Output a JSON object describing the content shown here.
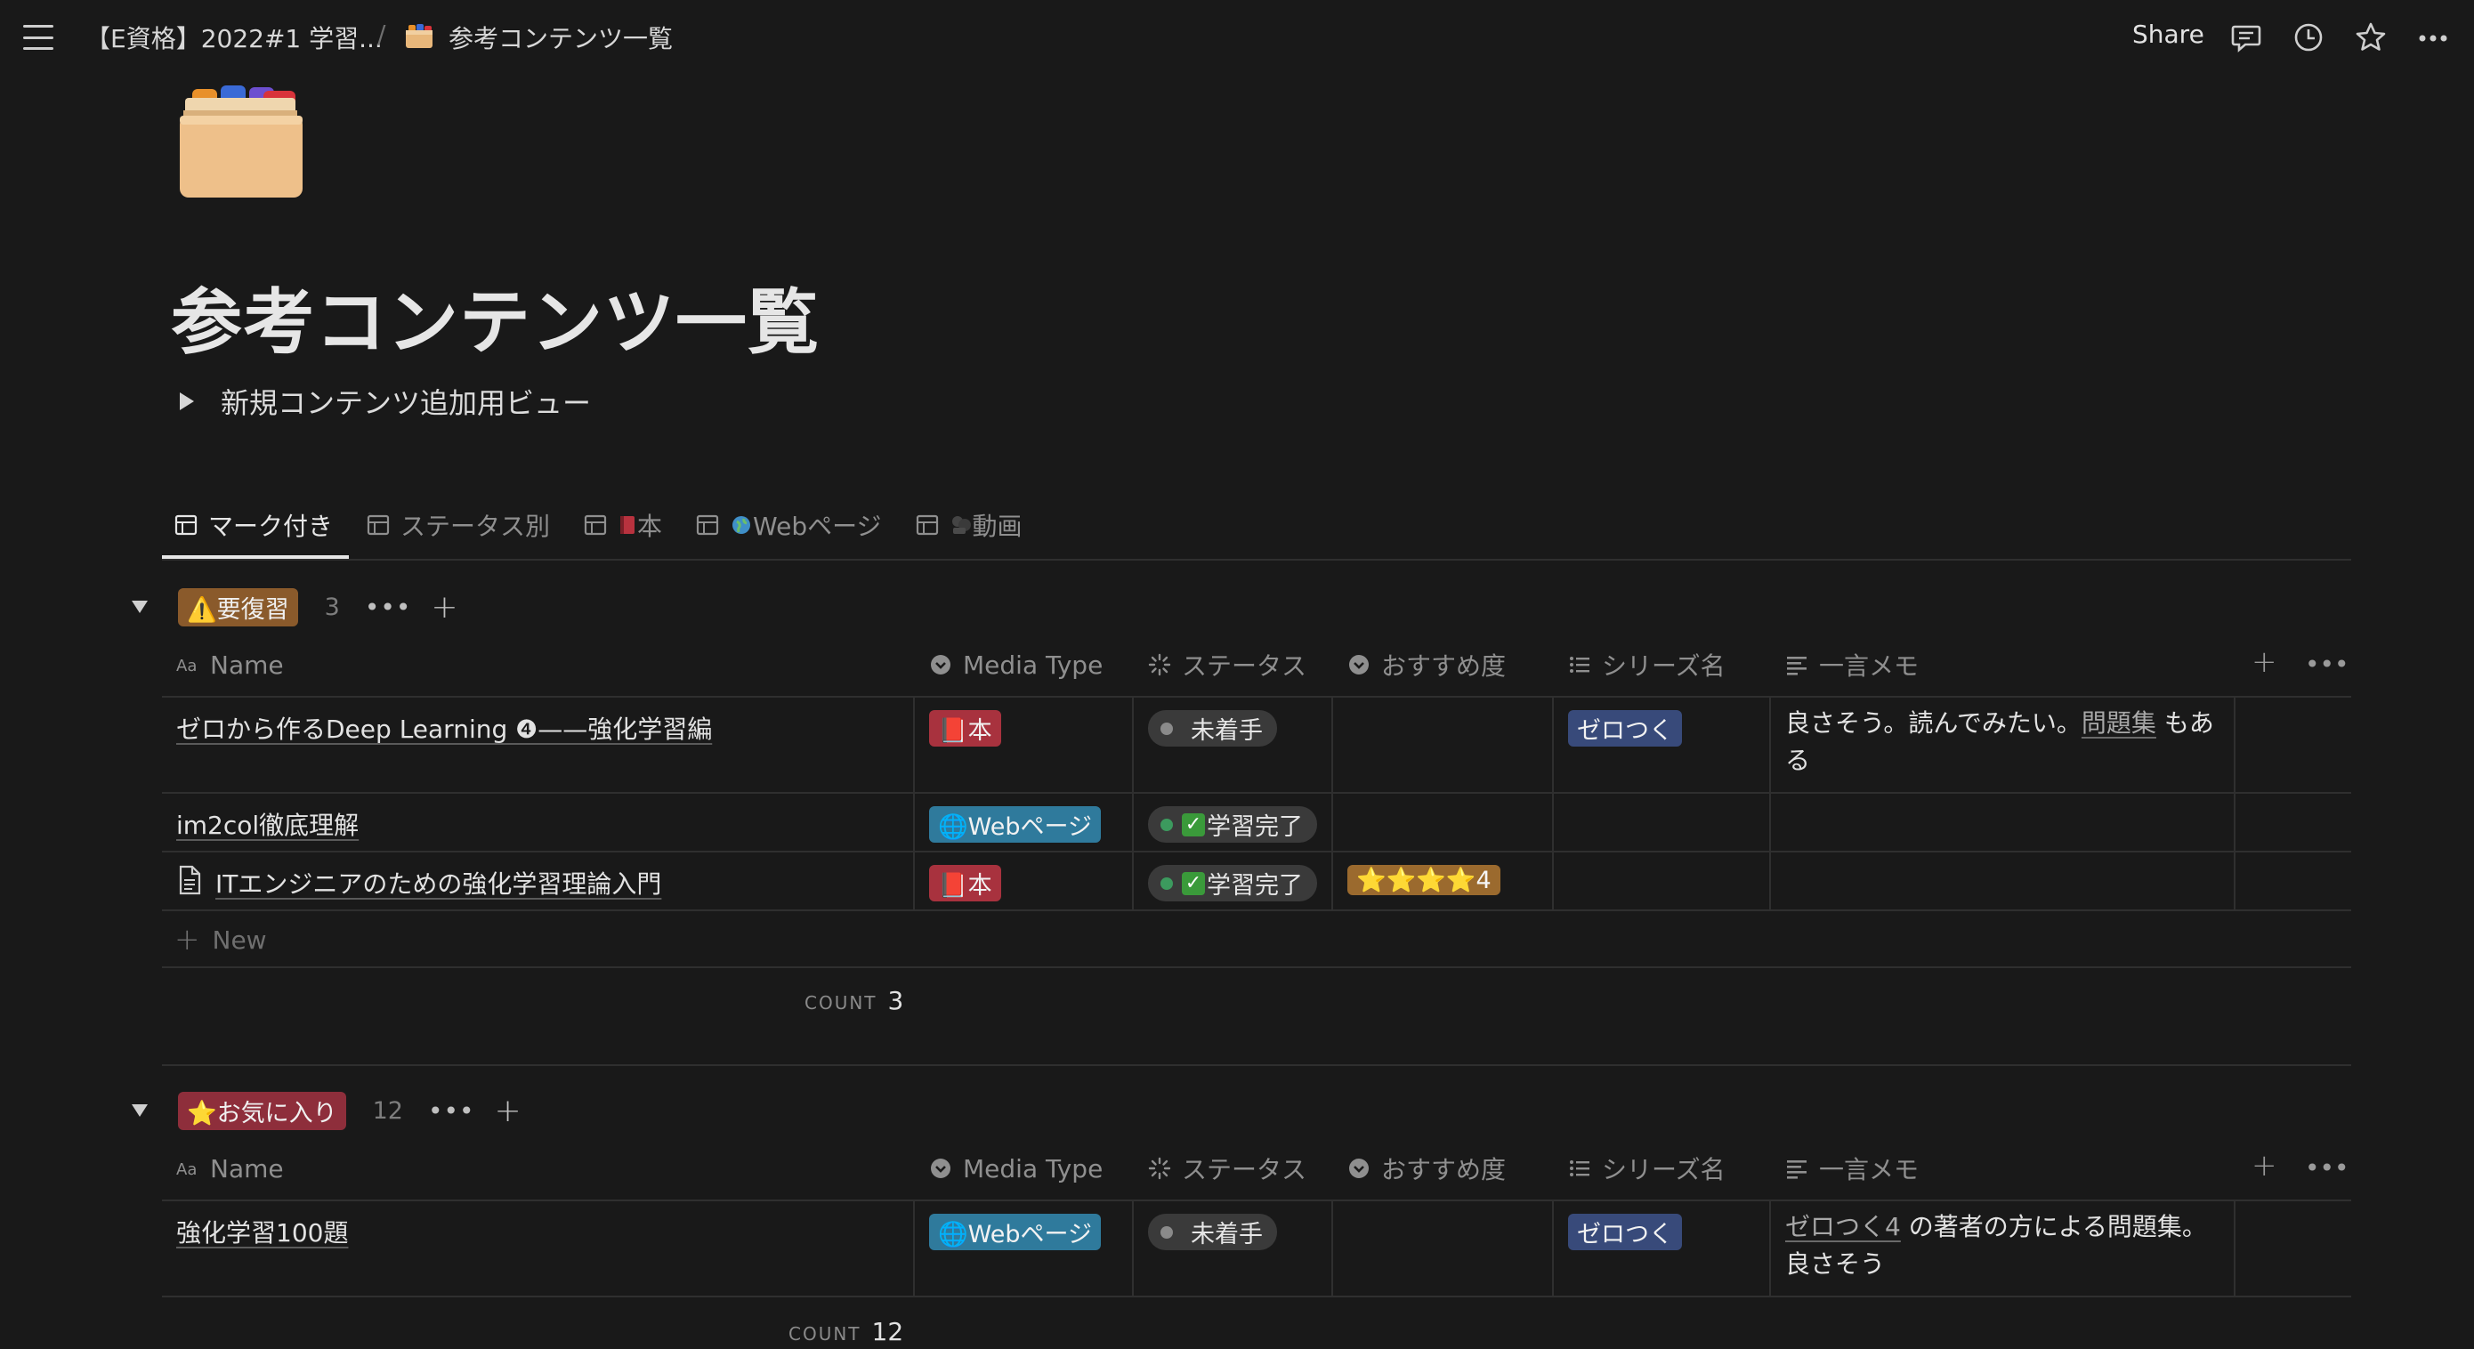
{
  "topbar": {
    "workspace_crumb": "【E資格】2022#1 学習...",
    "separator": "/",
    "page_crumb": "参考コンテンツ一覧",
    "share_label": "Share"
  },
  "page": {
    "title": "参考コンテンツ一覧",
    "toggle_label": "新規コンテンツ追加用ビュー"
  },
  "tabs": [
    {
      "label": "マーク付き"
    },
    {
      "label": "ステータス別"
    },
    {
      "label": "本"
    },
    {
      "label": "Webページ"
    },
    {
      "label": "動画"
    }
  ],
  "columns": {
    "name": "Name",
    "media_type": "Media Type",
    "status": "ステータス",
    "recommend": "おすすめ度",
    "series": "シリーズ名",
    "memo": "一言メモ"
  },
  "groups": [
    {
      "label": "⚠️要復習",
      "count": "3",
      "rows": [
        {
          "name": "ゼロから作るDeep Learning ❹——強化学習編",
          "media": "📕本",
          "status": "未着手",
          "recommend": "",
          "series": "ゼロつく",
          "memo_pre": "良さそう。読んでみたい。",
          "memo_link": "問題集",
          "memo_post": " もある"
        },
        {
          "name": "im2col徹底理解",
          "media": "🌐Webページ",
          "status": "学習完了",
          "recommend": "",
          "series": "",
          "memo_pre": "",
          "memo_link": "",
          "memo_post": ""
        },
        {
          "name": "ITエンジニアのための強化学習理論入門",
          "media": "📕本",
          "status": "学習完了",
          "recommend": "⭐⭐⭐⭐4",
          "series": "",
          "memo_pre": "",
          "memo_link": "",
          "memo_post": ""
        }
      ],
      "new_label": "New",
      "count_label": "COUNT",
      "count_value": "3"
    },
    {
      "label": "⭐お気に入り",
      "count": "12",
      "rows": [
        {
          "name": "強化学習100題",
          "media": "🌐Webページ",
          "status": "未着手",
          "recommend": "",
          "series": "ゼロつく",
          "memo_pre": "",
          "memo_link": "ゼロつく4",
          "memo_post": " の著者の方による問題集。良さそう"
        }
      ],
      "count_label": "COUNT",
      "count_value": "12"
    }
  ],
  "colors": {
    "background": "#191919",
    "book_tag": "#a8323e",
    "web_tag": "#2f7a9c",
    "series_tag": "#384a7a",
    "warn_badge": "#8a5a2b",
    "fav_badge": "#8e2e3b"
  }
}
